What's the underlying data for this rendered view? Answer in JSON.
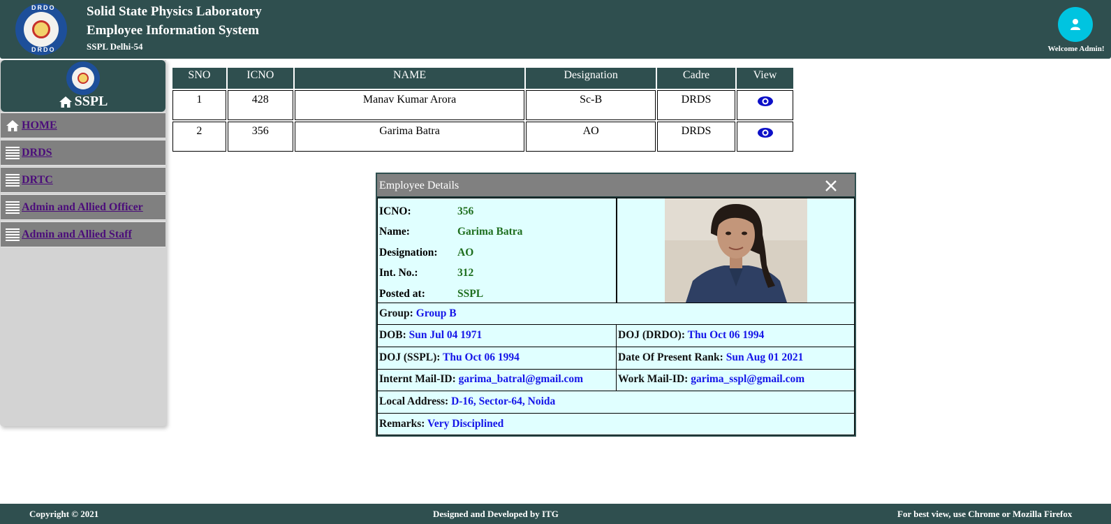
{
  "header": {
    "title_line1": "Solid State Physics Laboratory",
    "title_line2": "Employee Information System",
    "subtitle": "SSPL Delhi-54",
    "logo_text_top": "DRDO",
    "logo_text_bottom": "DRDO",
    "welcome": "Welcome Admin!"
  },
  "sidebar": {
    "brand": "SSPL",
    "items": [
      {
        "label": "HOME",
        "icon": "home-icon"
      },
      {
        "label": "DRDS",
        "icon": "list-icon"
      },
      {
        "label": "DRTC",
        "icon": "list-icon"
      },
      {
        "label": "Admin and Allied Officer",
        "icon": "list-icon"
      },
      {
        "label": "Admin and Allied Staff",
        "icon": "list-icon"
      }
    ]
  },
  "table": {
    "headers": [
      "SNO",
      "ICNO",
      "NAME",
      "Designation",
      "Cadre",
      "View"
    ],
    "rows": [
      {
        "sno": "1",
        "icno": "428",
        "name": "Manav Kumar Arora",
        "designation": "Sc-B",
        "cadre": "DRDS",
        "view_icon": "eye-icon"
      },
      {
        "sno": "2",
        "icno": "356",
        "name": "Garima Batra",
        "designation": "AO",
        "cadre": "DRDS",
        "view_icon": "eye-icon"
      }
    ]
  },
  "modal": {
    "title": "Employee Details",
    "fields": {
      "icno_label": "ICNO:",
      "icno": "356",
      "name_label": "Name:",
      "name": "Garima Batra",
      "designation_label": "Designation:",
      "designation": "AO",
      "intno_label": "Int. No.:",
      "intno": "312",
      "posted_label": "Posted at:",
      "posted": "SSPL",
      "group_label": "Group:",
      "group": "Group B",
      "dob_label": "DOB:",
      "dob": "Sun Jul 04 1971",
      "doj_drdo_label": "DOJ (DRDO):",
      "doj_drdo": "Thu Oct 06 1994",
      "doj_sspl_label": "DOJ (SSPL):",
      "doj_sspl": "Thu Oct 06 1994",
      "present_rank_label": "Date Of Present Rank:",
      "present_rank": "Sun Aug 01 2021",
      "internet_mail_label": "Internt Mail-ID:",
      "internet_mail": "garima_batral@gmail.com",
      "work_mail_label": "Work Mail-ID:",
      "work_mail": "garima_sspl@gmail.com",
      "address_label": "Local Address:",
      "address": "D-16, Sector-64, Noida",
      "remarks_label": "Remarks:",
      "remarks": "Very Disciplined"
    }
  },
  "footer": {
    "copyright": "Copyright © 2021",
    "designed_by": "Designed and Developed by ITG",
    "best_view": "For best view, use Chrome or Mozilla Firefox"
  },
  "colors": {
    "header_bg": "#2f4f4f",
    "sidebar_bg": "#d3d3d3",
    "nav_bg": "#808080",
    "nav_link": "#4b0d7a",
    "modal_bg": "#e0ffff",
    "value_green": "#1e6e1e",
    "value_blue": "#1515e8",
    "avatar_bg": "#00c4e0"
  }
}
